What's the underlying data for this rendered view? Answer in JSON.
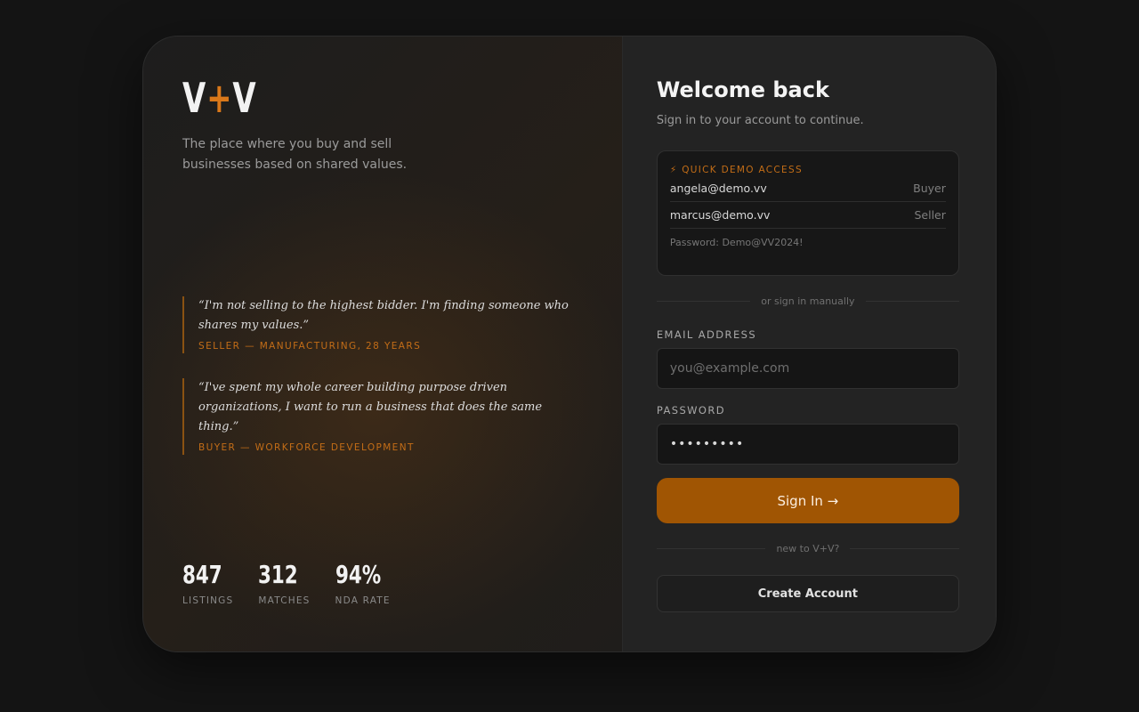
{
  "brand": {
    "logo_left": "V",
    "logo_plus": "+",
    "logo_right": "V",
    "tagline": "The place where you buy and sell businesses based on shared values.",
    "accent_color": "#c36d17"
  },
  "quotes": [
    {
      "text": "“I'm not selling to the highest bidder. I'm finding someone who shares my values.”",
      "attribution": "SELLER — MANUFACTURING, 28 YEARS"
    },
    {
      "text": "“I've spent my whole career building purpose driven organizations, I want to run a business that does the same thing.”",
      "attribution": "BUYER — WORKFORCE DEVELOPMENT"
    }
  ],
  "stats": [
    {
      "value": "847",
      "label": "LISTINGS"
    },
    {
      "value": "312",
      "label": "MATCHES"
    },
    {
      "value": "94%",
      "label": "NDA RATE"
    }
  ],
  "signin": {
    "title": "Welcome back",
    "subtitle": "Sign in to your account to continue.",
    "demo": {
      "icon": "lightning-icon",
      "icon_glyph": "⚡",
      "heading": "QUICK DEMO ACCESS",
      "accounts": [
        {
          "email": "angela@demo.vv",
          "role": "Buyer"
        },
        {
          "email": "marcus@demo.vv",
          "role": "Seller"
        }
      ],
      "password_note": "Password: Demo@VV2024!"
    },
    "divider_manual": "or sign in manually",
    "email_label": "EMAIL ADDRESS",
    "email_placeholder": "you@example.com",
    "email_value": "",
    "password_label": "PASSWORD",
    "password_value": "•••••••••",
    "submit_label": "Sign In →",
    "divider_new": "new to V+V?",
    "create_label": "Create Account"
  }
}
